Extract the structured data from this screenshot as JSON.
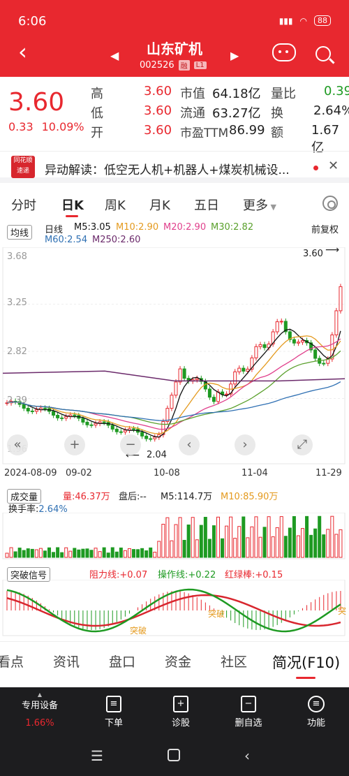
{
  "status_bar": {
    "time": "6:06",
    "battery": "88"
  },
  "header": {
    "stock_name": "山东矿机",
    "stock_code": "002526",
    "tag1": "融",
    "tag2": "L1"
  },
  "quote": {
    "price": "3.60",
    "change": "0.33",
    "change_pct": "10.09%",
    "high_label": "高",
    "high": "3.60",
    "low_label": "低",
    "low": "3.60",
    "open_label": "开",
    "open": "3.60",
    "mktcap_label": "市值",
    "mktcap": "64.18亿",
    "float_label": "流通",
    "float_cap": "63.27亿",
    "pe_label": "市盈TTM",
    "pe": "86.99",
    "ratio_label": "量比",
    "ratio": "0.39",
    "turnover_label": "换",
    "turnover": "2.64%",
    "amount_label": "额",
    "amount": "1.67亿"
  },
  "news": {
    "logo": "同花顺 速递",
    "text": "异动解读：低空无人机+机器人+煤炭机械设..."
  },
  "tabs": [
    "分时",
    "日K",
    "周K",
    "月K",
    "五日",
    "更多"
  ],
  "active_tab": "日K",
  "kline": {
    "ma_selector": "均线",
    "period": "日线",
    "ma5": "M5:3.05",
    "ma10": "M10:2.90",
    "ma20": "M20:2.90",
    "ma30": "M30:2.82",
    "ma60": "M60:2.54",
    "ma250": "M250:2.60",
    "adjust": "前复权",
    "y_ticks": [
      "3.68",
      "3.25",
      "2.82",
      "2.39",
      "1.96"
    ],
    "x_ticks": [
      "2024-08-09",
      "09-02",
      "10-08",
      "11-04",
      "11-29"
    ],
    "high_marker": "3.60",
    "low_marker": "2.04",
    "colors": {
      "ma5": "#111111",
      "ma10": "#e49a1e",
      "ma20": "#e0408c",
      "ma30": "#5aa02c",
      "ma60": "#2f70b3",
      "ma250": "#6b2a6b",
      "up": "#e8282f",
      "down": "#1e9a22"
    }
  },
  "volume": {
    "selector": "成交量",
    "volume": "量:46.37万",
    "after_hours": "盘后:--",
    "m5": "M5:114.7万",
    "m10": "M10:85.90万",
    "turnover_label": "换手率:",
    "turnover": "2.64%"
  },
  "signal": {
    "selector": "突破信号",
    "resistance": "阻力线:+0.07",
    "operation": "操作线:+0.22",
    "redgreen": "红绿棒:+0.15",
    "break_label": "突破"
  },
  "bottom_tabs": [
    "看点",
    "资讯",
    "盘口",
    "资金",
    "社区",
    "简况(F10)"
  ],
  "active_bottom_tab": "简况(F10)",
  "toolbar": {
    "device_label": "专用设备",
    "device_pct": "1.66%",
    "order": "下单",
    "diagnose": "诊股",
    "remove": "删自选",
    "functions": "功能"
  }
}
